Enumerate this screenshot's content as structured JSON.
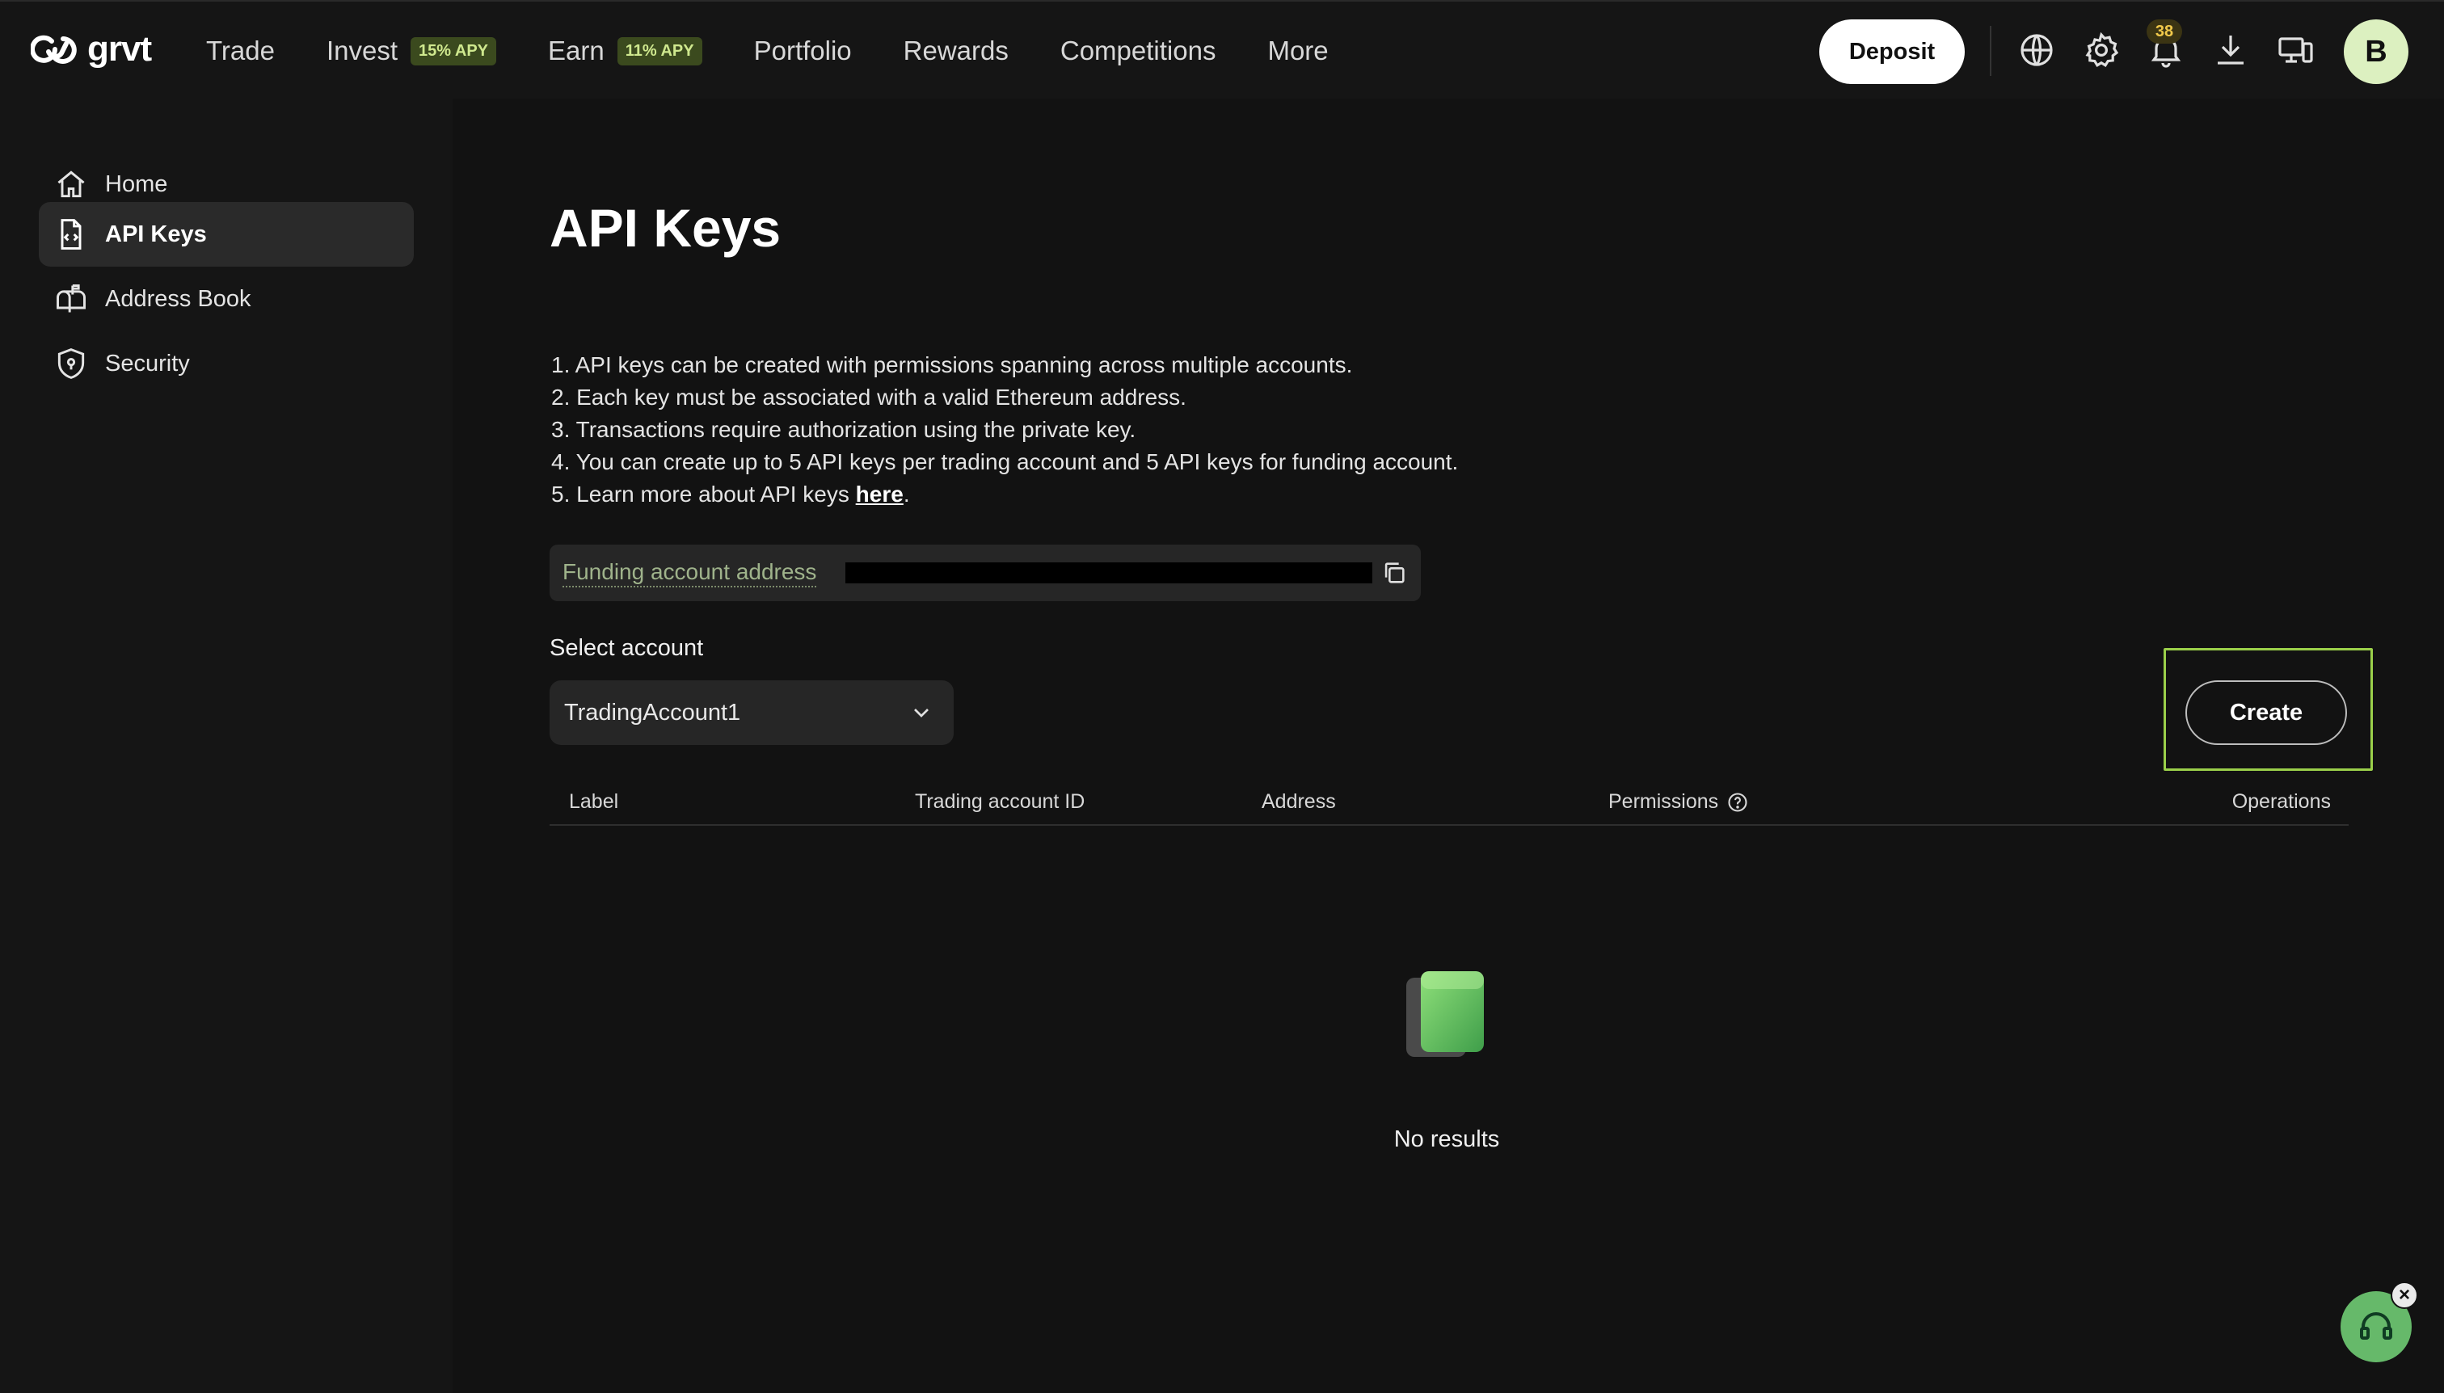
{
  "brand": {
    "name": "grvt"
  },
  "nav": {
    "items": [
      {
        "label": "Trade",
        "badge": ""
      },
      {
        "label": "Invest",
        "badge": "15% APY"
      },
      {
        "label": "Earn",
        "badge": "11% APY"
      },
      {
        "label": "Portfolio",
        "badge": ""
      },
      {
        "label": "Rewards",
        "badge": ""
      },
      {
        "label": "Competitions",
        "badge": ""
      },
      {
        "label": "More",
        "badge": ""
      }
    ],
    "deposit_label": "Deposit",
    "notification_count": "38",
    "avatar_initial": "B"
  },
  "sidebar": {
    "items": [
      {
        "label": "Home",
        "icon": "home-icon"
      },
      {
        "label": "API Keys",
        "icon": "api-key-icon"
      },
      {
        "label": "Address Book",
        "icon": "mailbox-icon"
      },
      {
        "label": "Security",
        "icon": "shield-icon"
      }
    ],
    "active": "API Keys"
  },
  "main": {
    "title": "API Keys",
    "info": [
      "1. API keys can be created with permissions spanning across multiple accounts.",
      "2. Each key must be associated with a valid Ethereum address.",
      "3. Transactions require authorization using the private key.",
      "4. You can create up to 5 API keys per trading account and 5 API keys for funding account."
    ],
    "info_last_prefix": "5. Learn more about API keys ",
    "info_last_link": "here",
    "info_last_suffix": ".",
    "funding_label": "Funding account address",
    "select_label": "Select account",
    "selected_account": "TradingAccount1",
    "create_label": "Create",
    "table_columns": {
      "label": "Label",
      "trading_account_id": "Trading account ID",
      "address": "Address",
      "permissions": "Permissions",
      "operations": "Operations"
    },
    "empty_text": "No results"
  },
  "colors": {
    "background": "#121212",
    "panel": "#151515",
    "accent": "#9bd04a",
    "badge_bg": "#3b4a1e",
    "badge_text": "#cfe88e"
  }
}
